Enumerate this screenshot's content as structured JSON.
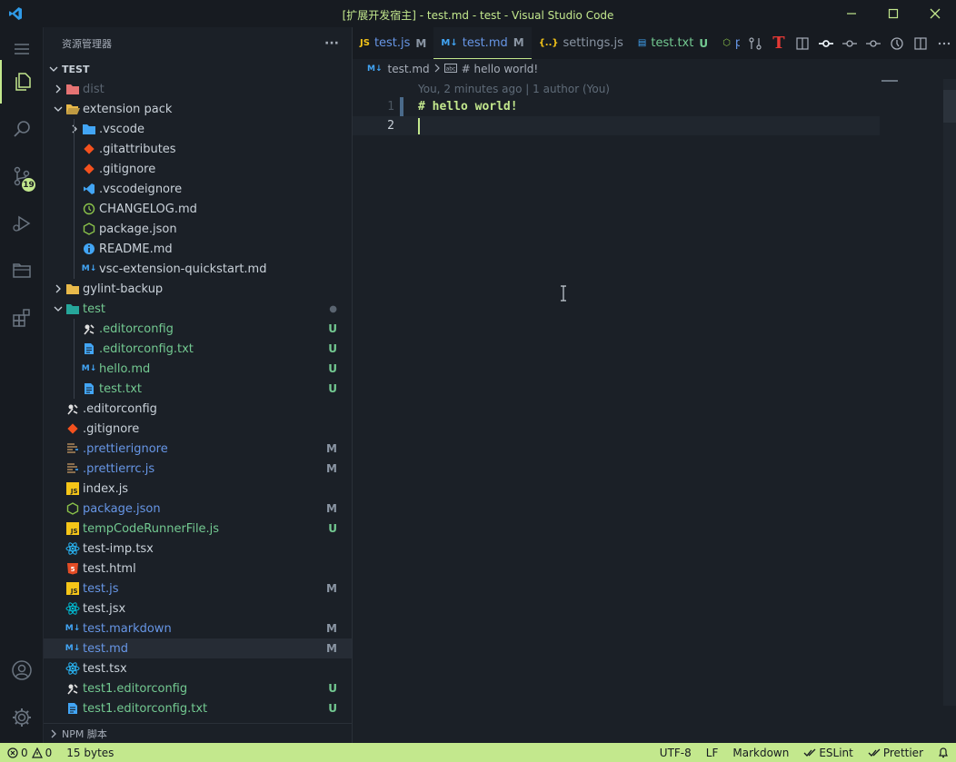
{
  "window": {
    "title": "[扩展开发宿主] - test.md - test - Visual Studio Code"
  },
  "activity_bar": {
    "source_control_badge": "19"
  },
  "sidebar": {
    "header_title": "资源管理器",
    "more_label": "···",
    "section_title": "TEST",
    "footer_label": "NPM 脚本",
    "tree": [
      {
        "label": "dist",
        "depth": 1,
        "type": "folder",
        "expanded": false,
        "color": "#5a6470",
        "icon_color": "#e57373",
        "icon": "folder-icon",
        "status": ""
      },
      {
        "label": "extension pack",
        "depth": 1,
        "type": "folder",
        "expanded": true,
        "color": "#c9d1d9",
        "icon_color": "#e8b94a",
        "icon": "folder-open-icon",
        "status": ""
      },
      {
        "label": ".vscode",
        "depth": 2,
        "type": "folder",
        "expanded": false,
        "color": "#c9d1d9",
        "icon_color": "#42a5f5",
        "icon": "vscode-folder-icon",
        "status": ""
      },
      {
        "label": ".gitattributes",
        "depth": 2,
        "type": "file",
        "color": "#c9d1d9",
        "icon_color": "#f4511e",
        "icon": "git-icon",
        "status": ""
      },
      {
        "label": ".gitignore",
        "depth": 2,
        "type": "file",
        "color": "#c9d1d9",
        "icon_color": "#f4511e",
        "icon": "git-icon",
        "status": ""
      },
      {
        "label": ".vscodeignore",
        "depth": 2,
        "type": "file",
        "color": "#c9d1d9",
        "icon_color": "#42a5f5",
        "icon": "vscode-icon",
        "status": ""
      },
      {
        "label": "CHANGELOG.md",
        "depth": 2,
        "type": "file",
        "color": "#c9d1d9",
        "icon_color": "#8bc34a",
        "icon": "changelog-icon",
        "status": ""
      },
      {
        "label": "package.json",
        "depth": 2,
        "type": "file",
        "color": "#c9d1d9",
        "icon_color": "#8bc34a",
        "icon": "nodejs-icon",
        "status": ""
      },
      {
        "label": "README.md",
        "depth": 2,
        "type": "file",
        "color": "#c9d1d9",
        "icon_color": "#42a5f5",
        "icon": "info-icon",
        "status": ""
      },
      {
        "label": "vsc-extension-quickstart.md",
        "depth": 2,
        "type": "file",
        "color": "#c9d1d9",
        "icon_color": "#42a5f5",
        "icon": "markdown-icon",
        "status": ""
      },
      {
        "label": "gylint-backup",
        "depth": 1,
        "type": "folder",
        "expanded": false,
        "color": "#c9d1d9",
        "icon_color": "#e8b94a",
        "icon": "folder-icon",
        "status": ""
      },
      {
        "label": "test",
        "depth": 1,
        "type": "folder",
        "expanded": true,
        "color": "#73c991",
        "icon_color": "#26a69a",
        "icon": "test-folder-icon",
        "status": "●",
        "status_color": "#5a6470"
      },
      {
        "label": ".editorconfig",
        "depth": 2,
        "type": "file",
        "color": "#73c991",
        "icon_color": "#e0e0e0",
        "icon": "editorconfig-icon",
        "status": "U",
        "status_color": "#73c991"
      },
      {
        "label": ".editorconfig.txt",
        "depth": 2,
        "type": "file",
        "color": "#73c991",
        "icon_color": "#42a5f5",
        "icon": "text-file-icon",
        "status": "U",
        "status_color": "#73c991"
      },
      {
        "label": "hello.md",
        "depth": 2,
        "type": "file",
        "color": "#73c991",
        "icon_color": "#42a5f5",
        "icon": "markdown-icon",
        "status": "U",
        "status_color": "#73c991"
      },
      {
        "label": "test.txt",
        "depth": 2,
        "type": "file",
        "color": "#73c991",
        "icon_color": "#42a5f5",
        "icon": "text-file-icon",
        "status": "U",
        "status_color": "#73c991"
      },
      {
        "label": ".editorconfig",
        "depth": 1,
        "type": "file",
        "color": "#c9d1d9",
        "icon_color": "#e0e0e0",
        "icon": "editorconfig-icon",
        "status": ""
      },
      {
        "label": ".gitignore",
        "depth": 1,
        "type": "file",
        "color": "#c9d1d9",
        "icon_color": "#f4511e",
        "icon": "git-icon",
        "status": ""
      },
      {
        "label": ".prettierignore",
        "depth": 1,
        "type": "file",
        "color": "#6796e6",
        "icon_color": "#b0885a",
        "icon": "prettier-icon",
        "status": "M",
        "status_color": "#8a95a3"
      },
      {
        "label": ".prettierrc.js",
        "depth": 1,
        "type": "file",
        "color": "#6796e6",
        "icon_color": "#b0885a",
        "icon": "prettier-icon",
        "status": "M",
        "status_color": "#8a95a3"
      },
      {
        "label": "index.js",
        "depth": 1,
        "type": "file",
        "color": "#c9d1d9",
        "icon_color": "#f5c518",
        "icon": "javascript-icon",
        "status": ""
      },
      {
        "label": "package.json",
        "depth": 1,
        "type": "file",
        "color": "#6796e6",
        "icon_color": "#8bc34a",
        "icon": "nodejs-icon",
        "status": "M",
        "status_color": "#8a95a3"
      },
      {
        "label": "tempCodeRunnerFile.js",
        "depth": 1,
        "type": "file",
        "color": "#73c991",
        "icon_color": "#f5c518",
        "icon": "javascript-icon",
        "status": "U",
        "status_color": "#73c991"
      },
      {
        "label": "test-imp.tsx",
        "depth": 1,
        "type": "file",
        "color": "#c9d1d9",
        "icon_color": "#29b6f6",
        "icon": "react-icon",
        "status": ""
      },
      {
        "label": "test.html",
        "depth": 1,
        "type": "file",
        "color": "#c9d1d9",
        "icon_color": "#e44d26",
        "icon": "html-icon",
        "status": ""
      },
      {
        "label": "test.js",
        "depth": 1,
        "type": "file",
        "color": "#6796e6",
        "icon_color": "#f5c518",
        "icon": "javascript-icon",
        "status": "M",
        "status_color": "#8a95a3"
      },
      {
        "label": "test.jsx",
        "depth": 1,
        "type": "file",
        "color": "#c9d1d9",
        "icon_color": "#00bcd4",
        "icon": "react-icon",
        "status": ""
      },
      {
        "label": "test.markdown",
        "depth": 1,
        "type": "file",
        "color": "#6796e6",
        "icon_color": "#42a5f5",
        "icon": "markdown-icon",
        "status": "M",
        "status_color": "#8a95a3"
      },
      {
        "label": "test.md",
        "depth": 1,
        "type": "file",
        "color": "#6796e6",
        "icon_color": "#42a5f5",
        "icon": "markdown-icon",
        "status": "M",
        "status_color": "#8a95a3",
        "selected": true
      },
      {
        "label": "test.tsx",
        "depth": 1,
        "type": "file",
        "color": "#c9d1d9",
        "icon_color": "#29b6f6",
        "icon": "react-icon",
        "status": ""
      },
      {
        "label": "test1.editorconfig",
        "depth": 1,
        "type": "file",
        "color": "#73c991",
        "icon_color": "#e0e0e0",
        "icon": "editorconfig-icon",
        "status": "U",
        "status_color": "#73c991"
      },
      {
        "label": "test1.editorconfig.txt",
        "depth": 1,
        "type": "file",
        "color": "#73c991",
        "icon_color": "#42a5f5",
        "icon": "text-file-icon",
        "status": "U",
        "status_color": "#73c991"
      }
    ]
  },
  "editor": {
    "tabs": [
      {
        "label": "test.js",
        "status": "M",
        "icon": "javascript-icon",
        "icon_text": "JS",
        "icon_color": "#f5c518",
        "color": "#6796e6",
        "status_color": "#8a95a3",
        "active": false
      },
      {
        "label": "test.md",
        "status": "M",
        "icon": "markdown-icon",
        "icon_text": "M↓",
        "icon_color": "#42a5f5",
        "color": "#6796e6",
        "status_color": "#8a95a3",
        "active": true
      },
      {
        "label": "settings.js",
        "status": "",
        "icon": "json-icon",
        "icon_text": "{..}",
        "icon_color": "#f5c518",
        "color": "#8a95a3",
        "status_color": "#8a95a3",
        "active": false
      },
      {
        "label": "test.txt",
        "status": "U",
        "icon": "text-file-icon",
        "icon_text": "▤",
        "icon_color": "#42a5f5",
        "color": "#73c991",
        "status_color": "#73c991",
        "active": false
      },
      {
        "label": "package.j",
        "status": "",
        "icon": "nodejs-icon",
        "icon_text": "⬡",
        "icon_color": "#8bc34a",
        "color": "#6796e6",
        "status_color": "#8a95a3",
        "active": false
      }
    ],
    "breadcrumbs": {
      "file": "test.md",
      "symbol": "# hello world!"
    },
    "codelens": "You, 2 minutes ago | 1 author (You)",
    "lines": [
      {
        "num": "1",
        "text": "# hello world!"
      },
      {
        "num": "2",
        "text": ""
      }
    ]
  },
  "statusbar": {
    "errors": "0",
    "warnings": "0",
    "size": "15 bytes",
    "encoding": "UTF-8",
    "eol": "LF",
    "language": "Markdown",
    "eslint": "ESLint",
    "prettier": "Prettier"
  }
}
